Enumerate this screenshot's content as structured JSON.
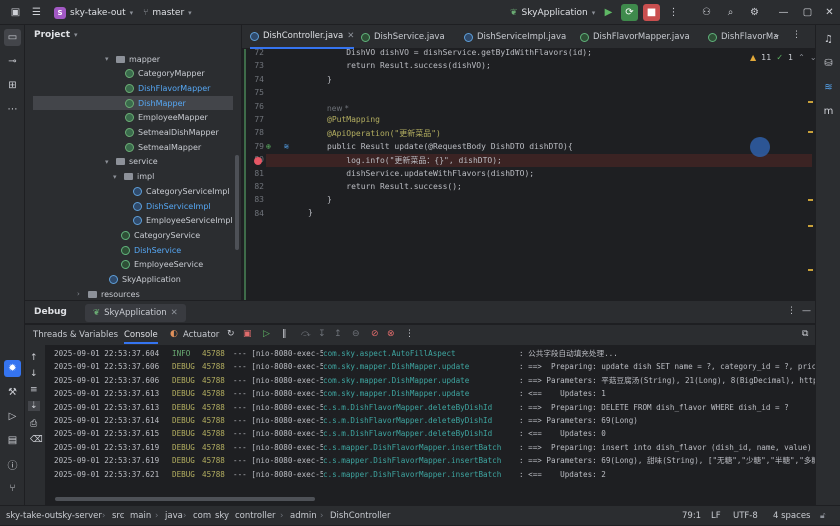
{
  "titlebar": {
    "project_badge": "S",
    "project_name": "sky-take-out",
    "branch": "master",
    "run_config": "SkyApplication"
  },
  "project_panel": {
    "title": "Project",
    "tree": [
      {
        "label": "mapper",
        "kind": "folder",
        "selected": false
      },
      {
        "label": "CategoryMapper",
        "kind": "mapper",
        "selected": false
      },
      {
        "label": "DishFlavorMapper",
        "kind": "mapper",
        "selected": false
      },
      {
        "label": "DishMapper",
        "kind": "mapper",
        "selected": true
      },
      {
        "label": "EmployeeMapper",
        "kind": "mapper",
        "selected": false
      },
      {
        "label": "SetmealDishMapper",
        "kind": "mapper",
        "selected": false
      },
      {
        "label": "SetmealMapper",
        "kind": "mapper",
        "selected": false
      },
      {
        "label": "service",
        "kind": "folder",
        "selected": false
      },
      {
        "label": "impl",
        "kind": "folder",
        "selected": false
      },
      {
        "label": "CategoryServiceImpl",
        "kind": "class",
        "selected": false
      },
      {
        "label": "DishServiceImpl",
        "kind": "class",
        "selected": false
      },
      {
        "label": "EmployeeServiceImpl",
        "kind": "class",
        "selected": false
      },
      {
        "label": "CategoryService",
        "kind": "iface",
        "selected": false
      },
      {
        "label": "DishService",
        "kind": "iface",
        "selected": false
      },
      {
        "label": "EmployeeService",
        "kind": "iface",
        "selected": false
      },
      {
        "label": "SkyApplication",
        "kind": "class",
        "selected": false
      },
      {
        "label": "resources",
        "kind": "folder",
        "selected": false
      }
    ]
  },
  "tabs": [
    {
      "label": "DishController.java",
      "active": true
    },
    {
      "label": "DishService.java",
      "active": false
    },
    {
      "label": "DishServiceImpl.java",
      "active": false
    },
    {
      "label": "DishFlavorMapper.java",
      "active": false
    },
    {
      "label": "DishFlavorMa",
      "active": false
    }
  ],
  "editor": {
    "warnings": "11",
    "checks": "1",
    "lines": [
      {
        "num": "72",
        "text": "    DishVO dishVO = dishService.getByIdWithFlavors(id);"
      },
      {
        "num": "73",
        "text": "    return Result.success(dishVO);"
      },
      {
        "num": "74",
        "text": "}"
      },
      {
        "num": "75",
        "text": ""
      },
      {
        "num": "76",
        "text": ""
      },
      {
        "num": "77",
        "text": "@PutMapping"
      },
      {
        "num": "78",
        "text": "@ApiOperation(\"更新菜品\")"
      },
      {
        "num": "79",
        "text": "public Result update(@RequestBody DishDTO dishDTO){"
      },
      {
        "num": "80",
        "text": "    log.info(\"更新菜品：{}\", dishDTO);"
      },
      {
        "num": "81",
        "text": "    dishService.updateWithFlavors(dishDTO);"
      },
      {
        "num": "82",
        "text": "    return Result.success();"
      },
      {
        "num": "83",
        "text": "}"
      },
      {
        "num": "84",
        "text": ""
      }
    ],
    "hint_new": "new *",
    "closing_brace": "}"
  },
  "debug": {
    "title": "Debug",
    "session": "SkyApplication",
    "tabs": [
      "Threads & Variables",
      "Console",
      "Actuator"
    ],
    "log": [
      {
        "ts": "2025-09-01 22:53:37.604",
        "level": "INFO",
        "pid": "45788",
        "thread": "--- [nio-8080-exec-5]",
        "logger": "com.sky.aspect.AutoFillAspect",
        "msg": ": 公共字段自动填充处理..."
      },
      {
        "ts": "2025-09-01 22:53:37.606",
        "level": "DEBUG",
        "pid": "45788",
        "thread": "--- [nio-8080-exec-5]",
        "logger": "com.sky.mapper.DishMapper.update",
        "msg": ": ==>  Preparing: update dish SET name = ?, category_id = ?, price"
      },
      {
        "ts": "2025-09-01 22:53:37.606",
        "level": "DEBUG",
        "pid": "45788",
        "thread": "--- [nio-8080-exec-5]",
        "logger": "com.sky.mapper.DishMapper.update",
        "msg": ": ==> Parameters: 平菇豆腐汤(String), 21(Long), 8(BigDecimal), https"
      },
      {
        "ts": "2025-09-01 22:53:37.613",
        "level": "DEBUG",
        "pid": "45788",
        "thread": "--- [nio-8080-exec-5]",
        "logger": "com.sky.mapper.DishMapper.update",
        "msg": ": <==    Updates: 1"
      },
      {
        "ts": "2025-09-01 22:53:37.613",
        "level": "DEBUG",
        "pid": "45788",
        "thread": "--- [nio-8080-exec-5]",
        "logger": "c.s.m.DishFlavorMapper.deleteByDishId",
        "msg": ": ==>  Preparing: DELETE FROM dish_flavor WHERE dish_id = ?"
      },
      {
        "ts": "2025-09-01 22:53:37.614",
        "level": "DEBUG",
        "pid": "45788",
        "thread": "--- [nio-8080-exec-5]",
        "logger": "c.s.m.DishFlavorMapper.deleteByDishId",
        "msg": ": ==> Parameters: 69(Long)"
      },
      {
        "ts": "2025-09-01 22:53:37.615",
        "level": "DEBUG",
        "pid": "45788",
        "thread": "--- [nio-8080-exec-5]",
        "logger": "c.s.m.DishFlavorMapper.deleteByDishId",
        "msg": ": <==    Updates: 0"
      },
      {
        "ts": "2025-09-01 22:53:37.619",
        "level": "DEBUG",
        "pid": "45788",
        "thread": "--- [nio-8080-exec-5]",
        "logger": "c.s.mapper.DishFlavorMapper.insertBatch",
        "msg": ": ==>  Preparing: insert into dish_flavor (dish_id, name, value) VA"
      },
      {
        "ts": "2025-09-01 22:53:37.619",
        "level": "DEBUG",
        "pid": "45788",
        "thread": "--- [nio-8080-exec-5]",
        "logger": "c.s.mapper.DishFlavorMapper.insertBatch",
        "msg": ": ==> Parameters: 69(Long), 甜味(String), [\"无糖\",\"少糖\",\"半糖\",\"多糖"
      },
      {
        "ts": "2025-09-01 22:53:37.621",
        "level": "DEBUG",
        "pid": "45788",
        "thread": "--- [nio-8080-exec-5]",
        "logger": "c.s.mapper.DishFlavorMapper.insertBatch",
        "msg": ": <==    Updates: 2"
      }
    ]
  },
  "status": {
    "crumbs": [
      "sky-take-out",
      "sky-server",
      "src",
      "main",
      "java",
      "com",
      "sky",
      "controller",
      "admin",
      "DishController"
    ],
    "position": "79:1",
    "line_ending": "LF",
    "encoding": "UTF-8",
    "indent": "4 spaces"
  }
}
